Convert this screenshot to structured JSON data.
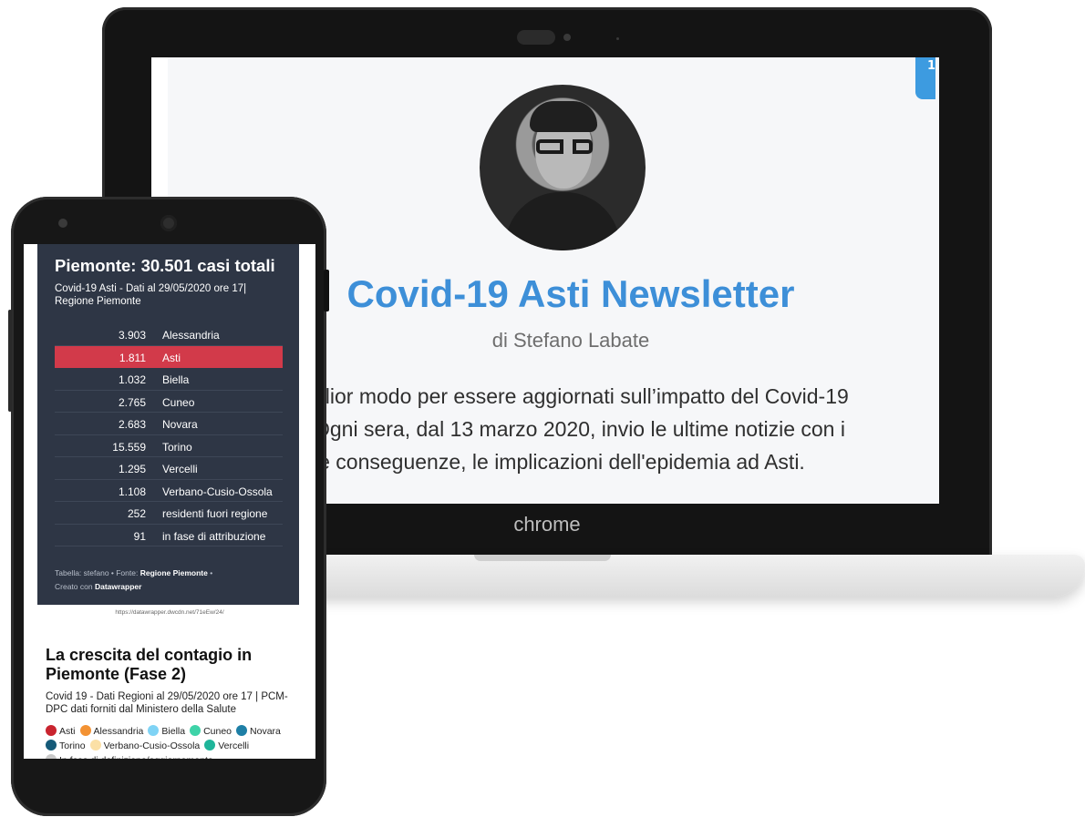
{
  "laptop": {
    "brand_label": "chrome",
    "corner_badge": "1",
    "newsletter": {
      "title": "Covid-19 Asti Newsletter",
      "author": "di Stefano Labate",
      "description_lines": [
        "glior modo per essere aggiornati sull’impatto del Covid-19",
        "Ogni sera, dal 13 marzo 2020, invio le ultime notizie con i",
        "le conseguenze, le implicazioni dell'epidemia ad Asti."
      ]
    },
    "colors": {
      "title": "#3d8fd8",
      "badge": "#3d9be0"
    }
  },
  "phone": {
    "table": {
      "title": "Piemonte: 30.501 casi totali",
      "subtitle": "Covid-19 Asti  - Dati al 29/05/2020 ore 17| Regione Piemonte",
      "rows": [
        {
          "value": "3.903",
          "name": "Alessandria"
        },
        {
          "value": "1.811",
          "name": "Asti",
          "highlight": true
        },
        {
          "value": "1.032",
          "name": "Biella"
        },
        {
          "value": "2.765",
          "name": "Cuneo"
        },
        {
          "value": "2.683",
          "name": "Novara"
        },
        {
          "value": "15.559",
          "name": "Torino"
        },
        {
          "value": "1.295",
          "name": "Vercelli"
        },
        {
          "value": "1.108",
          "name": "Verbano-Cusio-Ossola"
        },
        {
          "value": "252",
          "name": "residenti fuori regione"
        },
        {
          "value": "91",
          "name": "in fase di attribuzione"
        }
      ],
      "footer_prefix": "Tabella: stefano • Fonte: ",
      "footer_source": "Regione Piemonte",
      "footer_mid": " •",
      "footer_created": "Creato con ",
      "footer_tool": "Datawrapper",
      "highlight_color": "#d23a4a",
      "background_color": "#2e3645"
    },
    "url": "https://datawrapper.dwcdn.net/71eEw/24/",
    "section": {
      "title": "La crescita del contagio in Piemonte (Fase 2)",
      "subtitle": "Covid 19 - Dati Regioni al 29/05/2020 ore 17 | PCM-DPC dati forniti dal Ministero della Salute"
    },
    "legend": [
      {
        "label": "Asti",
        "color": "#c9242f"
      },
      {
        "label": "Alessandria",
        "color": "#f39233"
      },
      {
        "label": "Biella",
        "color": "#7fd3f5"
      },
      {
        "label": "Cuneo",
        "color": "#3ed3a8"
      },
      {
        "label": "Novara",
        "color": "#1e7fa6"
      },
      {
        "label": "Torino",
        "color": "#155a78"
      },
      {
        "label": "Verbano-Cusio-Ossola",
        "color": "#fbe0a6"
      },
      {
        "label": "Vercelli",
        "color": "#1fb59a"
      },
      {
        "label": "In fase di definizione/aggiornamento",
        "color": "#c8c8c8"
      }
    ]
  }
}
